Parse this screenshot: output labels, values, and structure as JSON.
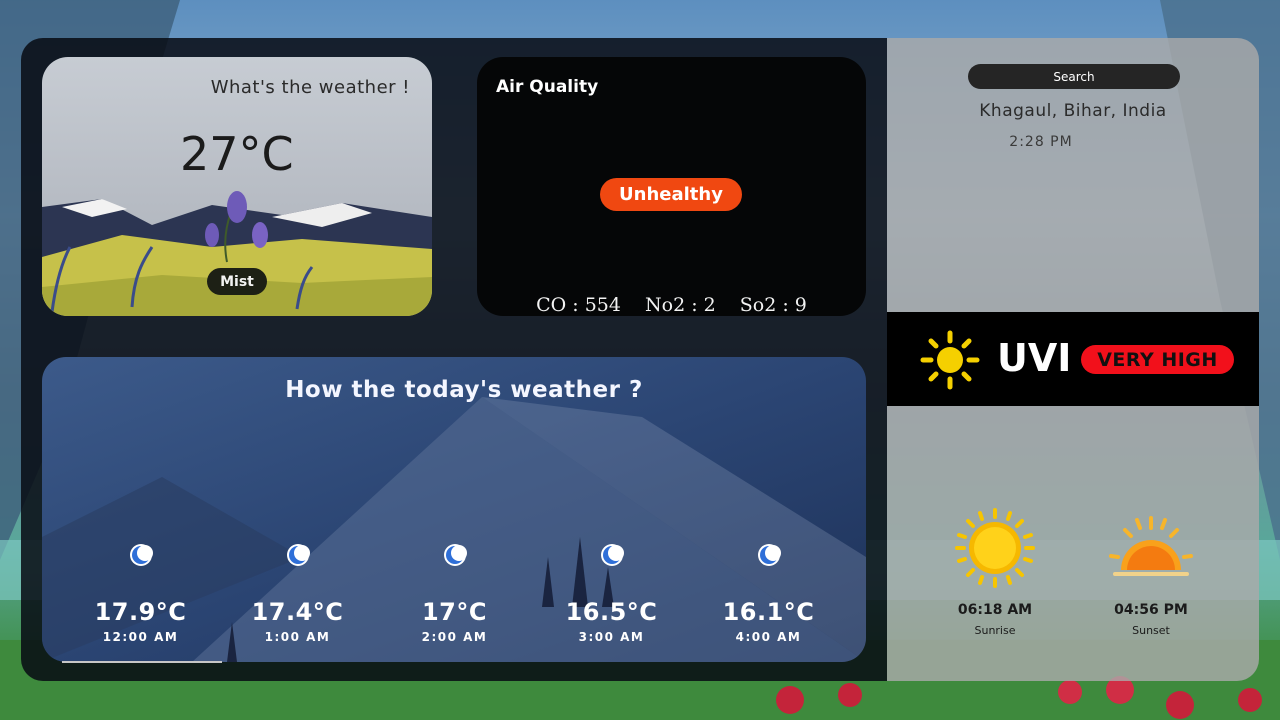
{
  "weather_card": {
    "question": "What's the weather !",
    "temperature": "27°C",
    "condition": "Mist"
  },
  "air_quality": {
    "title": "Air Quality",
    "status": "Unhealthy",
    "status_color": "#f04811",
    "pollutants": [
      {
        "label": "CO : 554"
      },
      {
        "label": "No2 : 2"
      },
      {
        "label": "So2 : 9"
      }
    ]
  },
  "forecast": {
    "title": "How the today's weather ?",
    "hours": [
      {
        "temp": "17.9°C",
        "time": "12:00 AM",
        "icon": "moon-icon"
      },
      {
        "temp": "17.4°C",
        "time": "1:00 AM",
        "icon": "moon-icon"
      },
      {
        "temp": "17°C",
        "time": "2:00 AM",
        "icon": "moon-icon"
      },
      {
        "temp": "16.5°C",
        "time": "3:00 AM",
        "icon": "moon-icon"
      },
      {
        "temp": "16.1°C",
        "time": "4:00 AM",
        "icon": "moon-icon"
      }
    ]
  },
  "sidebar": {
    "search_placeholder": "Search",
    "location": "Khagaul, Bihar, India",
    "local_time": "2:28 PM",
    "uvi": {
      "label": "UVI",
      "level": "VERY HIGH",
      "level_color": "#f2101b",
      "icon": "sun-icon"
    },
    "sunrise": {
      "time": "06:18 AM",
      "label": "Sunrise",
      "icon": "sunrise-icon"
    },
    "sunset": {
      "time": "04:56 PM",
      "label": "Sunset",
      "icon": "sunset-icon"
    }
  }
}
